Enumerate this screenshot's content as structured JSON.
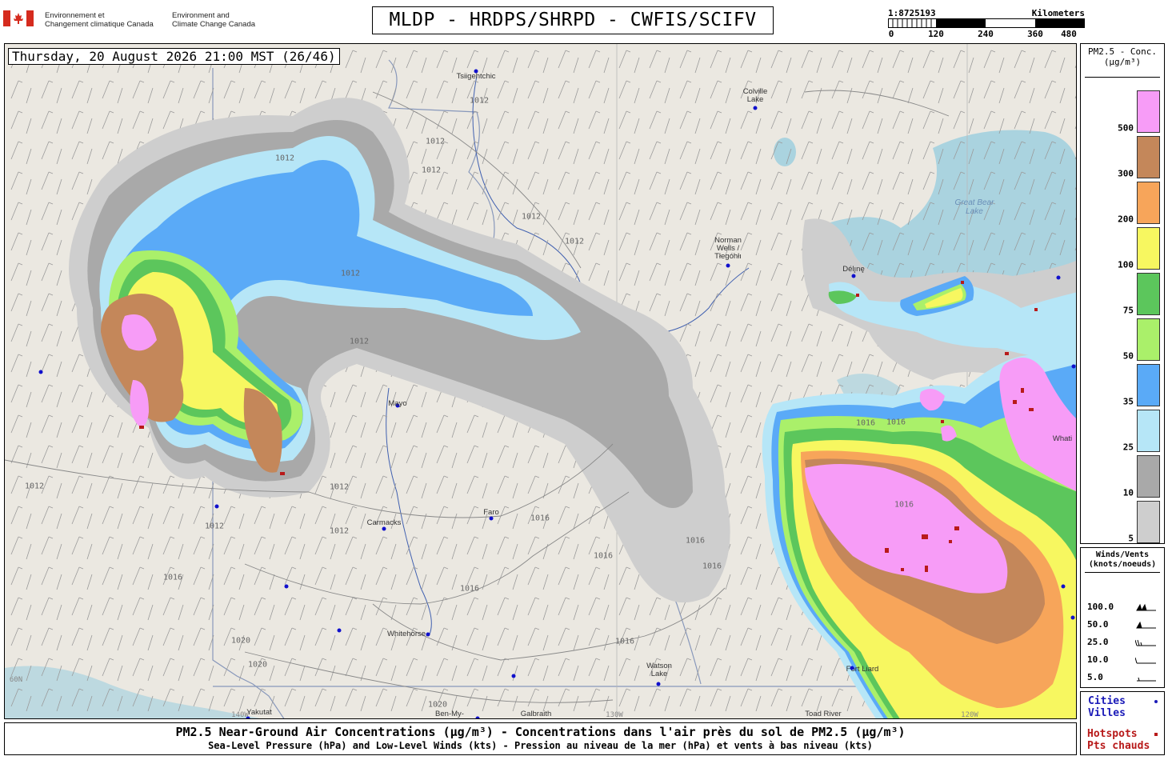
{
  "header": {
    "department_fr": "Environnement et\nChangement climatique Canada",
    "department_en": "Environment and\nClimate Change Canada",
    "model_title": "MLDP - HRDPS/SHRPD - CWFIS/SCIFV",
    "scale": {
      "ratio": "1:8725193",
      "unit": "Kilometers",
      "ticks": [
        "0",
        "120",
        "240",
        "360",
        "480"
      ]
    }
  },
  "map": {
    "timestamp": "Thursday, 20 August 2026 21:00 MST (26/46)",
    "colors": {
      "land": "#ebe8e1",
      "water": "#aad3df",
      "river": "#4060b0",
      "border": "#8898bb"
    },
    "cities": [
      {
        "name": "Tsiigehtchic"
      },
      {
        "name": "Colville\nLake"
      },
      {
        "name": "Norman\nWells /\nTłegóhłı"
      },
      {
        "name": "Délı̨nę"
      },
      {
        "name": "Mayo"
      },
      {
        "name": "Carmacks"
      },
      {
        "name": "Faro"
      },
      {
        "name": "Whitehorse"
      },
      {
        "name": "Watson\nLake"
      },
      {
        "name": "Yakutat"
      },
      {
        "name": "Galbraith"
      },
      {
        "name": "Ben-My-"
      },
      {
        "name": "Toad River"
      },
      {
        "name": "Fort Liard"
      },
      {
        "name": "Whati"
      }
    ],
    "lake_labels": [
      "Great Bear\nLake"
    ],
    "isobar_labels": [
      "1012",
      "1012",
      "1012",
      "1012",
      "1012",
      "1012",
      "1012",
      "1012",
      "1012",
      "1012",
      "1012",
      "1012",
      "1016",
      "1016",
      "1016",
      "1016",
      "1016",
      "1016",
      "1016",
      "1016",
      "1016",
      "1016",
      "1020",
      "1020",
      "1020"
    ],
    "grid_labels": [
      "60N",
      "130W",
      "120W",
      "140W"
    ]
  },
  "legend_pm25": {
    "title": "PM2.5 - Conc.\n(µg/m³)",
    "levels": [
      {
        "label": "500",
        "color": "#f79cf7"
      },
      {
        "label": "300",
        "color": "#c4875a"
      },
      {
        "label": "200",
        "color": "#f7a55a"
      },
      {
        "label": "100",
        "color": "#f7f760"
      },
      {
        "label": "75",
        "color": "#5cc65c"
      },
      {
        "label": "50",
        "color": "#aaf06a"
      },
      {
        "label": "35",
        "color": "#5aaaf7"
      },
      {
        "label": "25",
        "color": "#b6e6f7"
      },
      {
        "label": "10",
        "color": "#a9a9a9"
      },
      {
        "label": "5",
        "color": "#cecece"
      }
    ]
  },
  "legend_wind": {
    "title": "Winds/Vents\n(knots/noeuds)",
    "rows": [
      "100.0",
      "50.0",
      "25.0",
      "10.0",
      "5.0"
    ]
  },
  "legend_points": {
    "cities": "Cities\nVilles",
    "hotspots": "Hotspots\nPts chauds",
    "city_color": "#1a1ab8",
    "hotspot_color": "#b81a1a"
  },
  "footer": {
    "line1": "PM2.5 Near-Ground Air Concentrations (µg/m³) - Concentrations dans l'air près du sol de PM2.5 (µg/m³)",
    "line2": "Sea-Level Pressure (hPa) and Low-Level Winds (kts) - Pression au niveau de la mer (hPa) et vents à bas niveau (kts)"
  }
}
